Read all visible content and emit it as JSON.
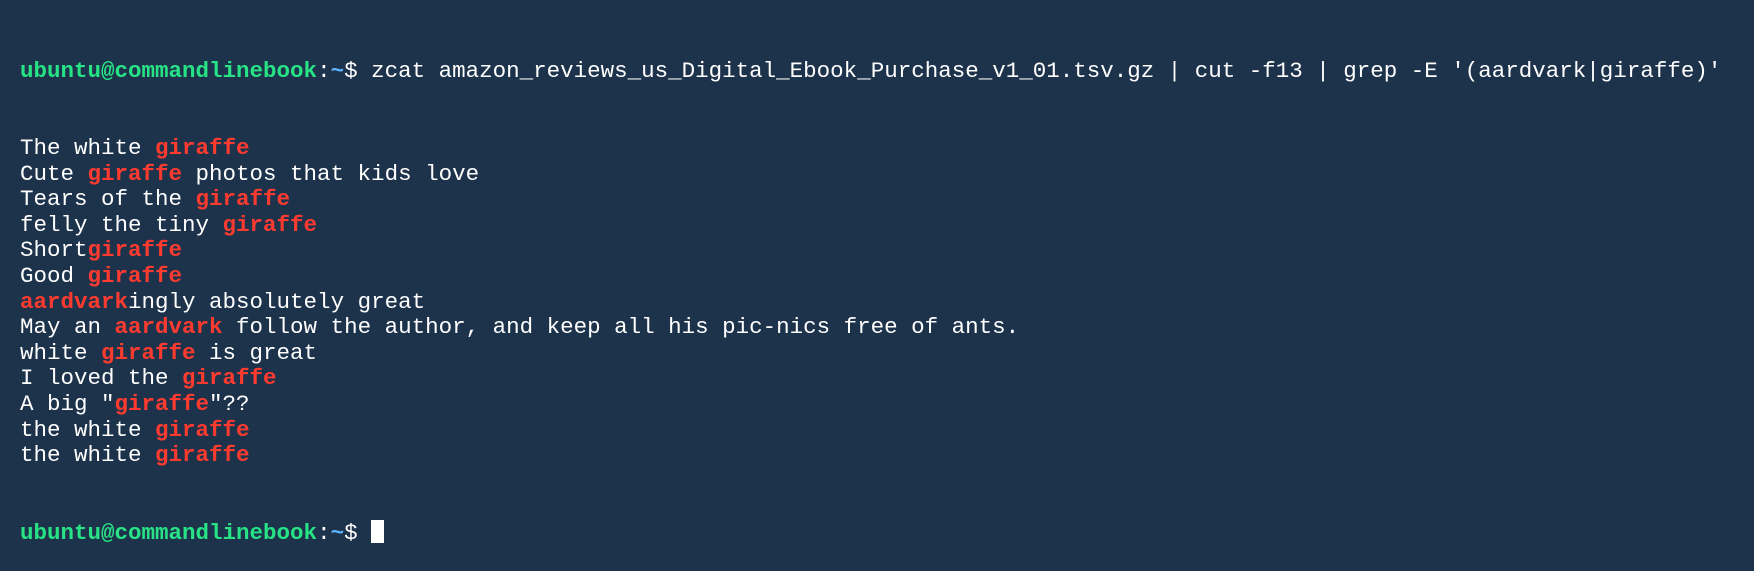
{
  "colors": {
    "background": "#1d324b",
    "text": "#ffffff",
    "prompt_user": "#27e385",
    "prompt_path": "#5fb3ff",
    "match_highlight": "#ff3b30",
    "cursor": "#ffffff"
  },
  "prompt": {
    "user_host": "ubuntu@commandlinebook",
    "separator": ":",
    "path": "~",
    "dollar": "$ "
  },
  "command": "zcat amazon_reviews_us_Digital_Ebook_Purchase_v1_01.tsv.gz | cut -f13 | grep -E '(aardvark|giraffe)'",
  "output_lines": [
    [
      "The white ",
      {
        "hl": "giraffe"
      }
    ],
    [
      "Cute ",
      {
        "hl": "giraffe"
      },
      " photos that kids love"
    ],
    [
      "Tears of the ",
      {
        "hl": "giraffe"
      }
    ],
    [
      "felly the tiny ",
      {
        "hl": "giraffe"
      }
    ],
    [
      "Short",
      {
        "hl": "giraffe"
      }
    ],
    [
      "Good ",
      {
        "hl": "giraffe"
      }
    ],
    [
      {
        "hl": "aardvark"
      },
      "ingly absolutely great"
    ],
    [
      "May an ",
      {
        "hl": "aardvark"
      },
      " follow the author, and keep all his pic-nics free of ants."
    ],
    [
      "white ",
      {
        "hl": "giraffe"
      },
      " is great"
    ],
    [
      "I loved the ",
      {
        "hl": "giraffe"
      }
    ],
    [
      "A big \"",
      {
        "hl": "giraffe"
      },
      "\"??"
    ],
    [
      "the white ",
      {
        "hl": "giraffe"
      }
    ],
    [
      "the white ",
      {
        "hl": "giraffe"
      }
    ]
  ]
}
